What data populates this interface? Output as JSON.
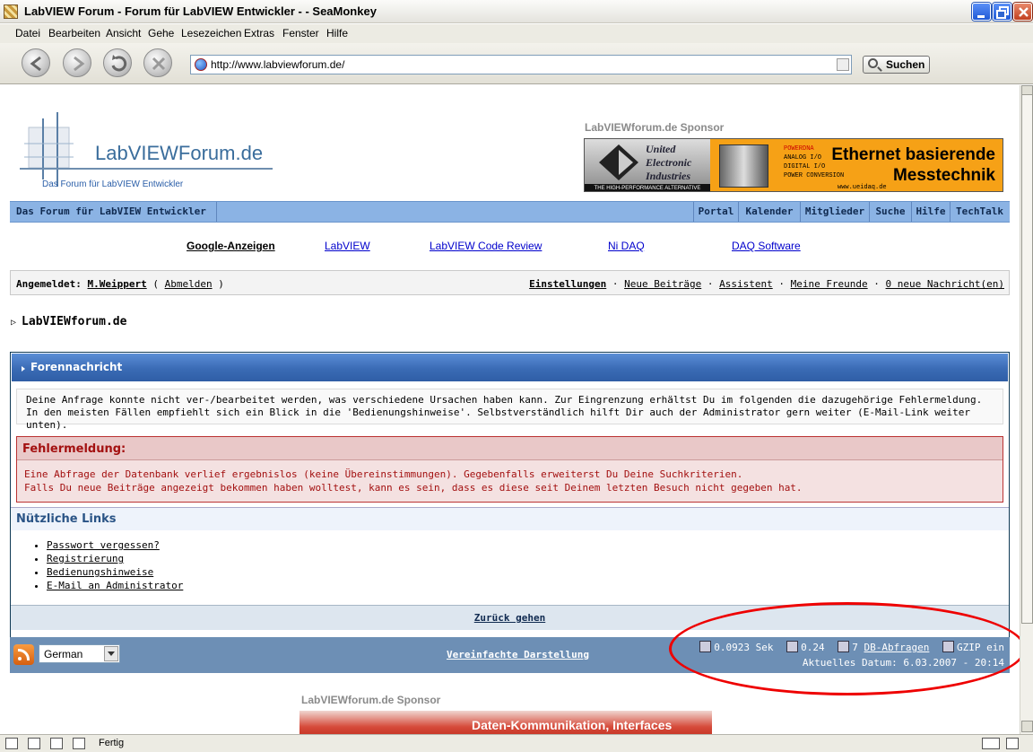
{
  "window": {
    "title": "LabVIEW Forum - Forum für LabVIEW Entwickler - - SeaMonkey"
  },
  "menu": [
    "Datei",
    "Bearbeiten",
    "Ansicht",
    "Gehe",
    "Lesezeichen",
    "Extras",
    "Fenster",
    "Hilfe"
  ],
  "browser": {
    "url": "http://www.labviewforum.de/",
    "search_label": "Suchen",
    "status": "Fertig"
  },
  "logo": {
    "title": "LabVIEWForum.de",
    "subtitle": "Das Forum für LabVIEW Entwickler"
  },
  "sponsor": {
    "label": "LabVIEWforum.de Sponsor",
    "top_banner": {
      "company": [
        "United",
        "Electronic",
        "Industries"
      ],
      "slogan": "THE HIGH-PERFORMANCE ALTERNATIVE",
      "features": [
        "POWERDNA",
        "ANALOG I/O",
        "DIGITAL I/O",
        "POWER CONVERSION"
      ],
      "headline": [
        "Ethernet basierende",
        "Messtechnik"
      ],
      "url": "www.ueidaq.de"
    },
    "bottom_banner": {
      "text": "Daten-Kommunikation, Interfaces"
    }
  },
  "forum_nav": {
    "home": "Das Forum für LabVIEW Entwickler",
    "links": [
      "Portal",
      "Kalender",
      "Mitglieder",
      "Suche",
      "Hilfe",
      "TechTalk"
    ]
  },
  "ads": {
    "header": "Google-Anzeigen",
    "links": [
      "LabVIEW",
      "LabVIEW Code Review",
      "Ni DAQ",
      "DAQ Software"
    ]
  },
  "login": {
    "prefix": "Angemeldet:",
    "user": "M.Weippert",
    "logout": "Abmelden",
    "settings": "Einstellungen",
    "new_posts": "Neue Beiträge",
    "assistant": "Assistent",
    "friends": "Meine Freunde",
    "messages": "0 neue Nachricht(en)"
  },
  "breadcrumb": "LabVIEWforum.de",
  "message": {
    "header": "Forennachricht",
    "intro": "Deine Anfrage konnte nicht ver-/bearbeitet werden, was verschiedene Ursachen haben kann. Zur Eingrenzung erhältst Du im folgenden die dazugehörige Fehlermeldung. In den meisten Fällen empfiehlt sich ein Blick in die 'Bedienungshinweise'. Selbstverständlich hilft Dir auch der Administrator gern weiter (E-Mail-Link weiter unten).",
    "error_title": "Fehlermeldung:",
    "error_lines": [
      "Eine Abfrage der Datenbank verlief ergebnislos (keine Übereinstimmungen). Gegebenfalls erweiterst Du Deine Suchkriterien.",
      "Falls Du neue Beiträge angezeigt bekommen haben wolltest, kann es sein, dass es diese seit Deinem letzten Besuch nicht gegeben hat."
    ],
    "links_title": "Nützliche Links",
    "links": [
      "Passwort vergessen?",
      "Registrierung",
      "Bedienungshinweise",
      "E-Mail an Administrator"
    ],
    "back": "Zurück gehen"
  },
  "footer": {
    "language": "German",
    "simple_view": "Vereinfachte Darstellung",
    "gen_time": "0.0923 Sek",
    "load": "0.24",
    "queries_count": "7",
    "queries_label": "DB-Abfragen",
    "gzip": "GZIP ein",
    "date": "Aktuelles Datum: 6.03.2007 - 20:14"
  },
  "colors": {
    "nav_bar": "#8bb3e4",
    "header": "#3a6bb5",
    "footer": "#6d8fb5",
    "error": "#a31010",
    "annotation": "#e00000"
  }
}
